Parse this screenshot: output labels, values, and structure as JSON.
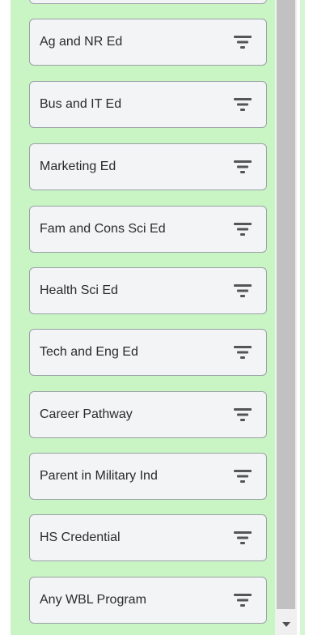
{
  "filter_panel": {
    "items": [
      {
        "label": ""
      },
      {
        "label": "Ag and NR Ed"
      },
      {
        "label": "Bus and IT Ed"
      },
      {
        "label": "Marketing Ed"
      },
      {
        "label": "Fam and Cons Sci Ed"
      },
      {
        "label": "Health Sci Ed"
      },
      {
        "label": "Tech and Eng Ed"
      },
      {
        "label": "Career Pathway"
      },
      {
        "label": "Parent in Military Ind"
      },
      {
        "label": "HS Credential"
      },
      {
        "label": "Any WBL Program"
      }
    ],
    "icon": "filter-icon",
    "background_color": "#c8f5c3",
    "item_background_color": "#f3f4f6",
    "icon_color": "#555555"
  },
  "scrollbar": {
    "scroll_down_icon": "triangle-down-icon"
  }
}
